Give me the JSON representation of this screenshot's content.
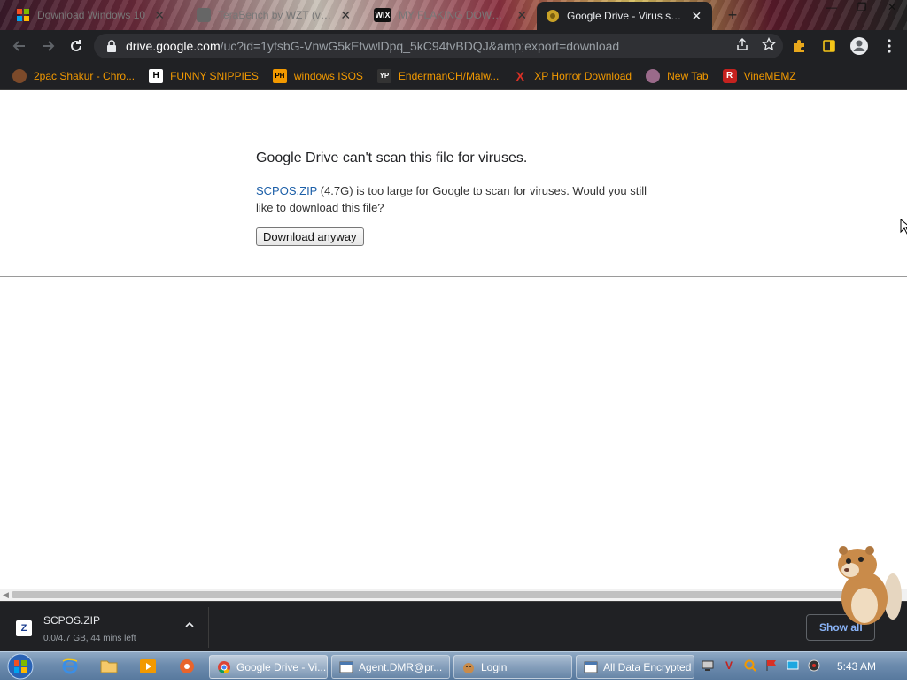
{
  "browser": {
    "tabs": [
      {
        "title": "Download Windows 10",
        "favicon": "windows-favicon",
        "active": false
      },
      {
        "title": "TeraBench by WZT (v1.1",
        "favicon": "tool-favicon",
        "active": false
      },
      {
        "title": "MY FLAKING DOWNLOA...",
        "favicon": "wix-favicon",
        "active": false
      },
      {
        "title": "Google Drive - Virus scan",
        "favicon": "drive-favicon",
        "active": true
      }
    ],
    "tab_close_glyph": "✕",
    "new_tab_glyph": "+",
    "window_buttons": {
      "minimize": "—",
      "restore": "❐",
      "close": "✕"
    },
    "url_host": "drive.google.com",
    "url_path": "/uc?id=1yfsbG-VnwG5kEfvwlDpq_5kC94tvBDQJ&amp;export=download",
    "bookmarks": [
      {
        "label": "2pac Shakur - Chro...",
        "icon": "puzzle-bookmark-icon",
        "icon_text": "",
        "icon_color": "#7c4a2a"
      },
      {
        "label": "FUNNY SNIPPIES",
        "icon": "h-bookmark-icon",
        "icon_text": "H",
        "icon_color": "#ffffff"
      },
      {
        "label": "windows ISOS",
        "icon": "ph-bookmark-icon",
        "icon_text": "PH",
        "icon_color": "#f29900"
      },
      {
        "label": "EndermanCH/Malw...",
        "icon": "yp-bookmark-icon",
        "icon_text": "YP",
        "icon_color": "#333333"
      },
      {
        "label": "XP Horror Download",
        "icon": "x-bookmark-icon",
        "icon_text": "X",
        "icon_color": "#d93025"
      },
      {
        "label": "New Tab",
        "icon": "globe-bookmark-icon",
        "icon_text": "",
        "icon_color": "#9a6a8a"
      },
      {
        "label": "VineMEMZ",
        "icon": "r-bookmark-icon",
        "icon_text": "R",
        "icon_color": "#c5221f"
      }
    ]
  },
  "page": {
    "title": "Google Drive can't scan this file for viruses.",
    "file_link": "SCPOS.ZIP",
    "file_size": " (4.7G)",
    "message": " is too large for Google to scan for viruses. Would you still like to download this file?",
    "download_button": "Download anyway"
  },
  "downloads": {
    "file_name": "SCPOS.ZIP",
    "status": "0.0/4.7 GB, 44 mins left",
    "show_all": "Show all"
  },
  "taskbar": {
    "tasks": [
      {
        "label": "Google Drive - Vi...",
        "icon": "chrome-task-icon",
        "active": true
      },
      {
        "label": "Agent.DMR@pr...",
        "icon": "window-task-icon",
        "active": false
      },
      {
        "label": "Login",
        "icon": "hamster-task-icon",
        "active": false
      },
      {
        "label": "All Data Encrypted",
        "icon": "window-task-icon",
        "active": false
      }
    ],
    "clock": "5:43 AM"
  },
  "colors": {
    "chrome_dark": "#202124",
    "bookmark_text": "#f29900",
    "link": "#1c5fa8",
    "shelf_link": "#8ab4f8"
  }
}
